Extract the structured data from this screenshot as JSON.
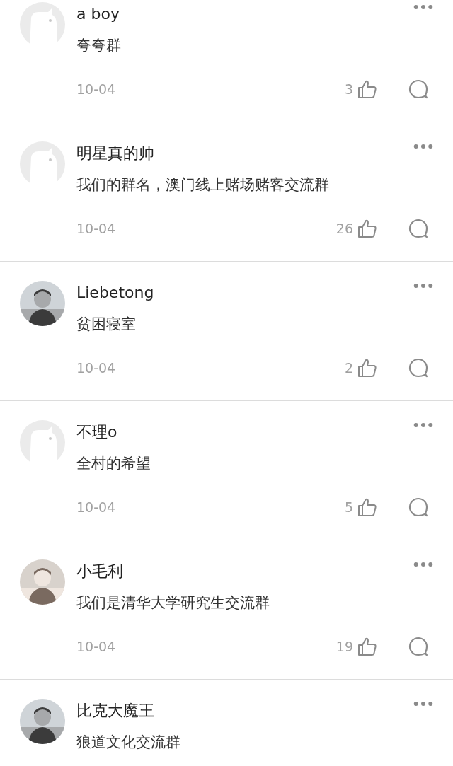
{
  "comments": [
    {
      "avatar": {
        "kind": "default"
      },
      "name": "a boy",
      "text": "夸夸群",
      "date": "10-04",
      "likes": "3"
    },
    {
      "avatar": {
        "kind": "default"
      },
      "name": "明星真的帅",
      "text": "我们的群名，澳门线上赌场赌客交流群",
      "date": "10-04",
      "likes": "26"
    },
    {
      "name": "Liebetong",
      "text": "贫困寝室",
      "date": "10-04",
      "likes": "2"
    },
    {
      "avatar": {
        "kind": "default"
      },
      "name": "不理o",
      "text": "全村的希望",
      "date": "10-04",
      "likes": "5"
    },
    {
      "name": "小毛利",
      "text": "我们是清华大学研究生交流群",
      "date": "10-04",
      "likes": "19"
    },
    {
      "name": "比克大魔王",
      "text": "狼道文化交流群"
    }
  ]
}
